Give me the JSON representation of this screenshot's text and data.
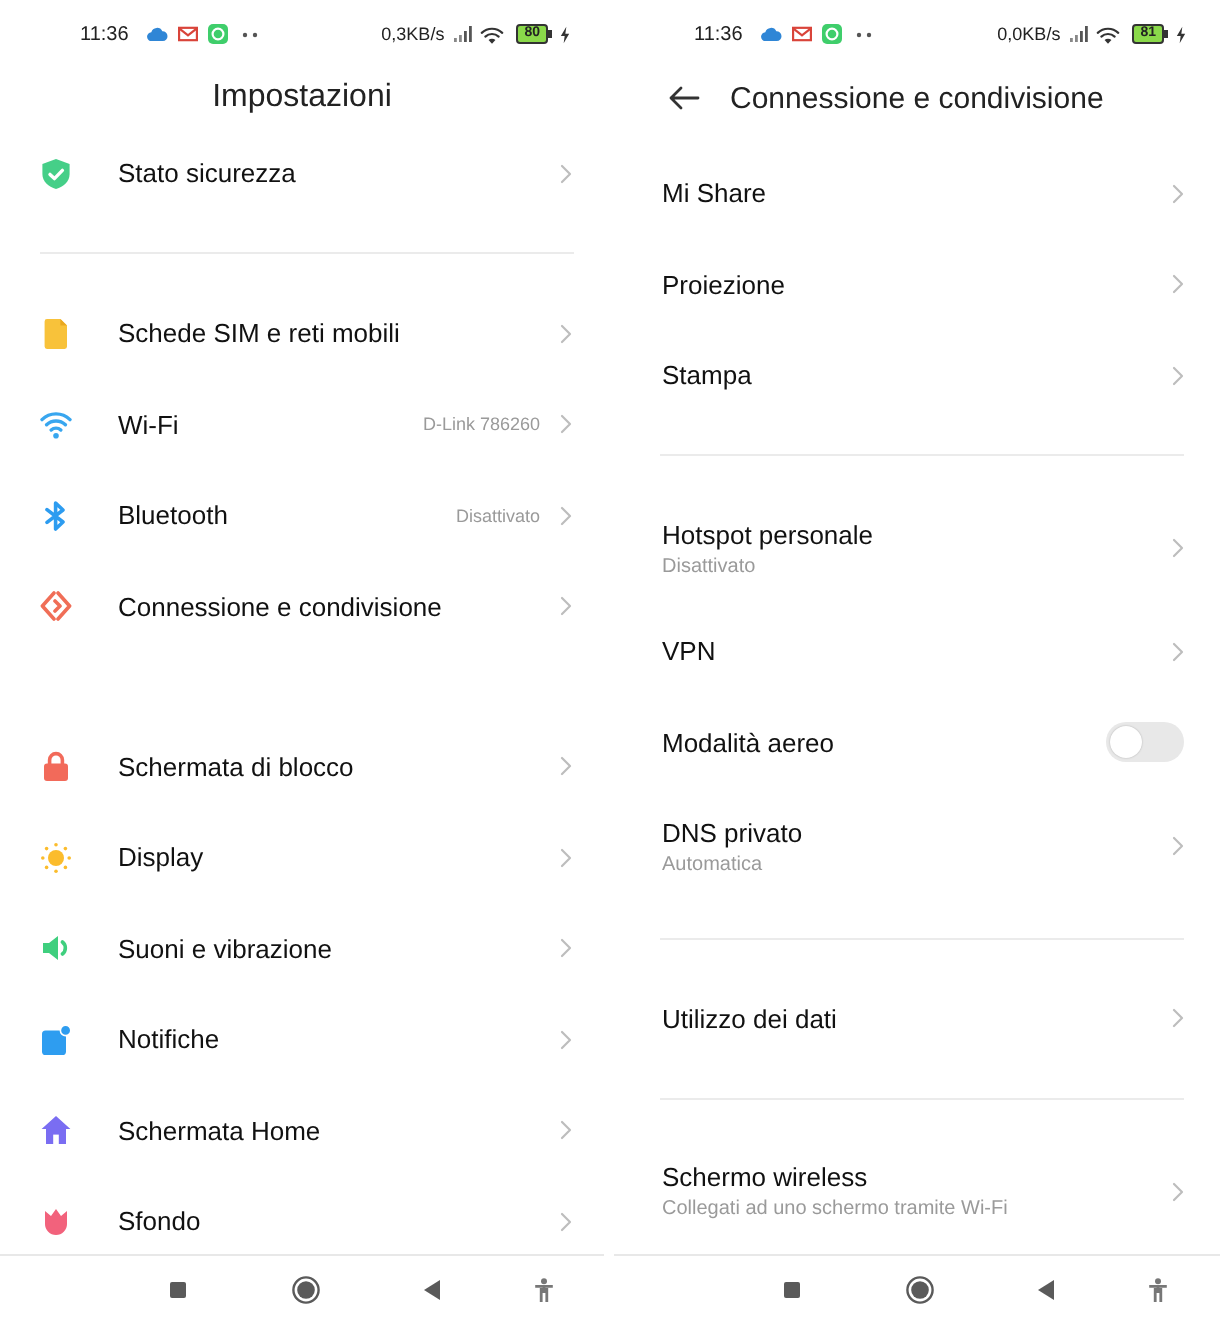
{
  "screens": [
    {
      "status_bar": {
        "time": "11:36",
        "network_speed": "0,3KB/s",
        "battery": "80"
      },
      "header": {
        "title": "Impostazioni"
      },
      "groups": [
        {
          "items": [
            {
              "kind": "category",
              "label": "Stato sicurezza"
            }
          ]
        },
        {
          "divider": true,
          "items": [
            {
              "kind": "category",
              "label": "Schede SIM e reti mobili"
            },
            {
              "kind": "category",
              "label": "Wi-Fi",
              "value": "D-Link 786260"
            },
            {
              "kind": "category",
              "label": "Bluetooth",
              "value": "Disattivato"
            },
            {
              "kind": "category",
              "label": "Connessione e condivisione"
            }
          ]
        },
        {
          "divider": false,
          "items": [
            {
              "kind": "category",
              "label": "Schermata di blocco"
            },
            {
              "kind": "category",
              "label": "Display"
            },
            {
              "kind": "category",
              "label": "Suoni e vibrazione"
            },
            {
              "kind": "category",
              "label": "Notifiche"
            },
            {
              "kind": "category",
              "label": "Schermata Home"
            },
            {
              "kind": "category",
              "label": "Sfondo"
            }
          ]
        }
      ]
    },
    {
      "status_bar": {
        "time": "11:36",
        "network_speed": "0,0KB/s",
        "battery": "81"
      },
      "header": {
        "title": "Connessione e condivisione",
        "back": true
      },
      "groups": [
        {
          "items": [
            {
              "kind": "link",
              "label": "Mi Share"
            },
            {
              "kind": "link",
              "label": "Proiezione"
            },
            {
              "kind": "link",
              "label": "Stampa"
            }
          ]
        },
        {
          "divider": true,
          "items": [
            {
              "kind": "link",
              "label": "Hotspot personale",
              "subtitle": "Disattivato"
            },
            {
              "kind": "link",
              "label": "VPN"
            },
            {
              "kind": "toggle",
              "label": "Modalità aereo",
              "on": false
            },
            {
              "kind": "link",
              "label": "DNS privato",
              "subtitle": "Automatica"
            }
          ]
        },
        {
          "divider": true,
          "items": [
            {
              "kind": "link",
              "label": "Utilizzo dei dati"
            }
          ]
        },
        {
          "divider": true,
          "items": [
            {
              "kind": "link",
              "label": "Schermo wireless",
              "subtitle": "Collegati ad uno schermo tramite Wi-Fi"
            }
          ]
        }
      ]
    }
  ]
}
